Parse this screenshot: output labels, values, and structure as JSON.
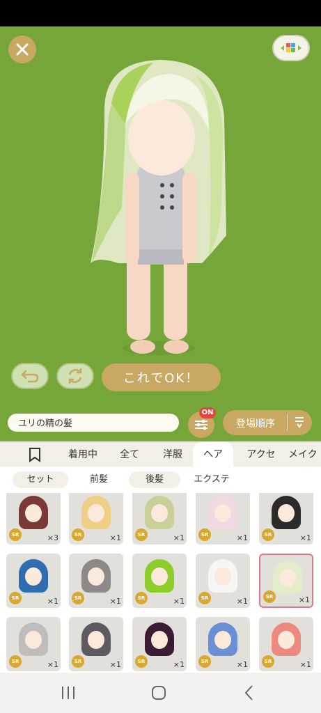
{
  "stage": {
    "ok_label": "これでOK！"
  },
  "search": {
    "value": "ユリの精の髪",
    "filter_badge": "ON",
    "sort_label": "登場順序"
  },
  "tabs": [
    {
      "label": "着用中"
    },
    {
      "label": "全て"
    },
    {
      "label": "洋服"
    },
    {
      "label": "ヘア",
      "active": true
    },
    {
      "label": "アクセ"
    },
    {
      "label": "メイク"
    }
  ],
  "subtabs": [
    {
      "label": "セット"
    },
    {
      "label": "前髪",
      "active": true
    },
    {
      "label": "後髪"
    },
    {
      "label": "エクステ"
    }
  ],
  "items": [
    {
      "rarity": "SR",
      "qty": "×3",
      "hair_color": "#7a3a36"
    },
    {
      "rarity": "SR",
      "qty": "×1",
      "hair_color": "#efcf86"
    },
    {
      "rarity": "SR",
      "qty": "×1",
      "hair_color": "#c9cf98"
    },
    {
      "rarity": "SR",
      "qty": "×1",
      "hair_color": "#f2d8e0"
    },
    {
      "rarity": "SR",
      "qty": "×1",
      "hair_color": "#2b2b2b"
    },
    {
      "rarity": "SR",
      "qty": "×1",
      "hair_color": "#2f6db0"
    },
    {
      "rarity": "SR",
      "qty": "×1",
      "hair_color": "#8b8a88"
    },
    {
      "rarity": "SR",
      "qty": "×1",
      "hair_color": "#8ccd2a"
    },
    {
      "rarity": "SR",
      "qty": "×1",
      "hair_color": "#f6f6f6"
    },
    {
      "rarity": "SR",
      "qty": "×1",
      "hair_color": "#e3ecc9",
      "selected": true
    },
    {
      "rarity": "SR",
      "qty": "×1",
      "hair_color": "#bdbdbd"
    },
    {
      "rarity": "SR",
      "qty": "×1",
      "hair_color": "#5e5a62"
    },
    {
      "rarity": "SR",
      "qty": "×1",
      "hair_color": "#3b1c33"
    },
    {
      "rarity": "SR",
      "qty": "×1",
      "hair_color": "#6a8fd6"
    },
    {
      "rarity": "SR",
      "qty": "×1",
      "hair_color": "#ec8a7f"
    }
  ],
  "colors": {
    "stage_bg": "#76a63a",
    "accent_gold": "#c9a864",
    "badge_red": "#e8453c",
    "selected_border": "#e07a8a"
  }
}
